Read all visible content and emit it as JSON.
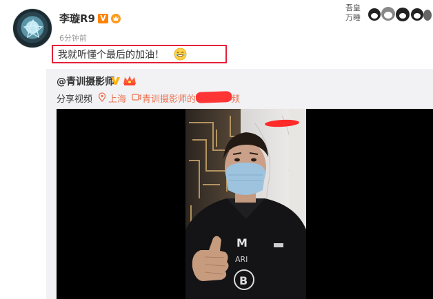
{
  "post": {
    "username": "李璇R9",
    "verified_badge": "V",
    "timestamp": "6分钟前",
    "text": "我就听懂个最后的加油！",
    "emoji": "laugh-emoji"
  },
  "repost": {
    "user": "@青训摄影师",
    "share_label": "分享视频",
    "location": "上海",
    "source_prefix": "青训摄影师的",
    "source_tail": "频"
  },
  "video": {
    "person": "man in mask giving thumbs up",
    "shirt_letters": "M ARI B"
  },
  "colors": {
    "accent_orange": "#ff8200",
    "link_orange": "#eb7350",
    "highlight_red": "#e4213a",
    "repost_bg": "#f2f2f5"
  }
}
